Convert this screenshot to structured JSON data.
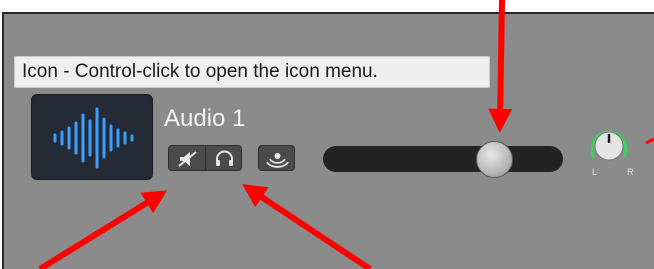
{
  "tooltip": {
    "text": "Icon - Control-click to open the icon menu."
  },
  "track": {
    "name": "Audio 1",
    "icon": "waveform-icon",
    "icon_color": "#39a0ff"
  },
  "buttons": {
    "mute": {
      "icon": "mute-speaker-icon"
    },
    "solo": {
      "icon": "headphones-icon"
    },
    "input_monitor": {
      "icon": "input-monitoring-icon"
    }
  },
  "volume": {
    "level": 0.7
  },
  "pan": {
    "left_label": "L",
    "right_label": "R",
    "ring_color": "#3cd35a"
  },
  "annotations": {
    "arrow_color": "#ff0000"
  }
}
